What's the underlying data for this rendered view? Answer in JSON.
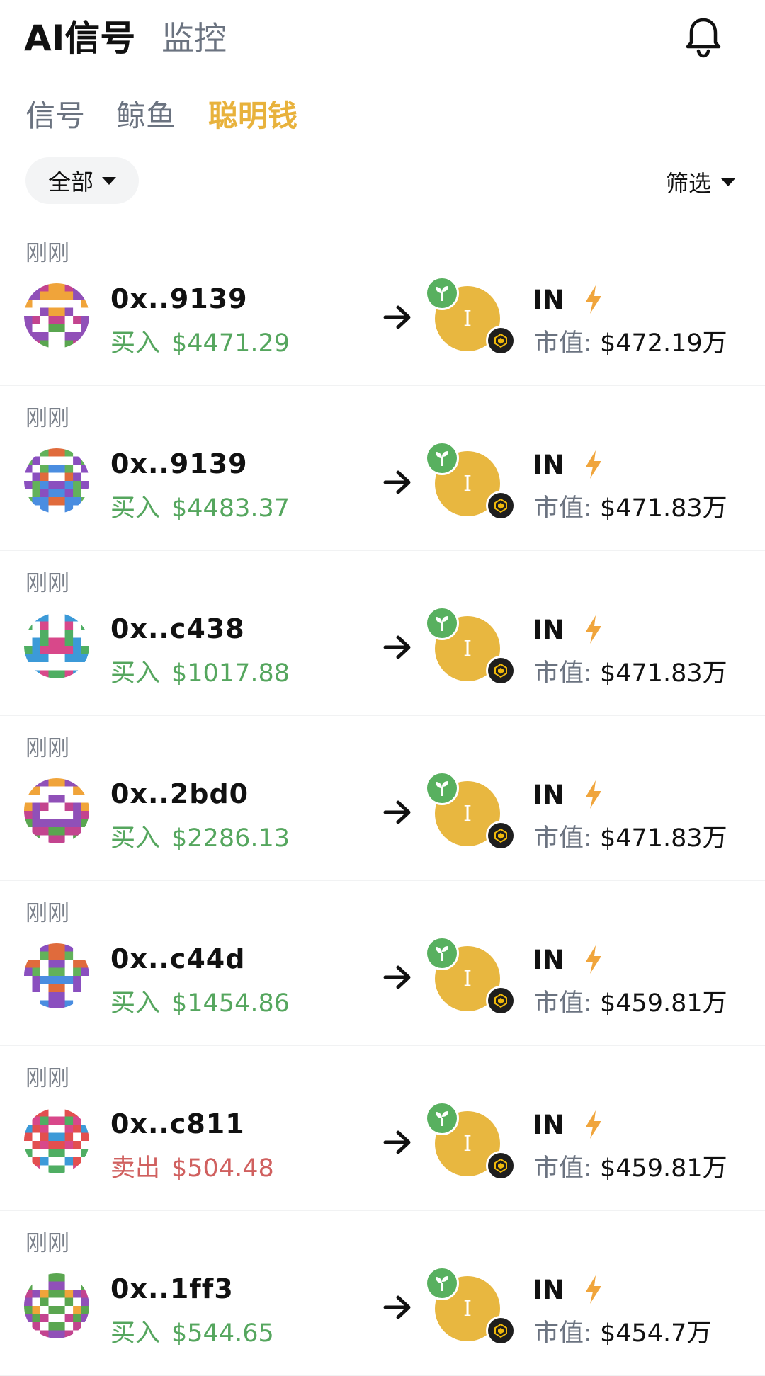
{
  "header": {
    "title": "AI信号",
    "subtitle": "监控"
  },
  "tabs": [
    {
      "label": "信号",
      "active": false
    },
    {
      "label": "鲸鱼",
      "active": false
    },
    {
      "label": "聪明钱",
      "active": true
    }
  ],
  "filters": {
    "scope_label": "全部",
    "filter_label": "筛选"
  },
  "colors": {
    "accent": "#e8b23c",
    "buy": "#55a65e",
    "sell": "#d0605f",
    "token_coin": "#e8b740"
  },
  "icons": {
    "bell": "bell-icon",
    "arrow": "arrow-right-icon",
    "bolt": "lightning-icon",
    "sprout": "sprout-icon",
    "chain": "bnb-chain-icon"
  },
  "feed": [
    {
      "time": "刚刚",
      "address": "0x..9139",
      "action": "买入",
      "type": "buy",
      "amount": "$4471.29",
      "token_letter": "I",
      "token": "IN",
      "mcap_label": "市值:",
      "mcap": "$472.19万"
    },
    {
      "time": "刚刚",
      "address": "0x..9139",
      "action": "买入",
      "type": "buy",
      "amount": "$4483.37",
      "token_letter": "I",
      "token": "IN",
      "mcap_label": "市值:",
      "mcap": "$471.83万"
    },
    {
      "time": "刚刚",
      "address": "0x..c438",
      "action": "买入",
      "type": "buy",
      "amount": "$1017.88",
      "token_letter": "I",
      "token": "IN",
      "mcap_label": "市值:",
      "mcap": "$471.83万"
    },
    {
      "time": "刚刚",
      "address": "0x..2bd0",
      "action": "买入",
      "type": "buy",
      "amount": "$2286.13",
      "token_letter": "I",
      "token": "IN",
      "mcap_label": "市值:",
      "mcap": "$471.83万"
    },
    {
      "time": "刚刚",
      "address": "0x..c44d",
      "action": "买入",
      "type": "buy",
      "amount": "$1454.86",
      "token_letter": "I",
      "token": "IN",
      "mcap_label": "市值:",
      "mcap": "$459.81万"
    },
    {
      "time": "刚刚",
      "address": "0x..c811",
      "action": "卖出",
      "type": "sell",
      "amount": "$504.48",
      "token_letter": "I",
      "token": "IN",
      "mcap_label": "市值:",
      "mcap": "$459.81万"
    },
    {
      "time": "刚刚",
      "address": "0x..1ff3",
      "action": "买入",
      "type": "buy",
      "amount": "$544.65",
      "token_letter": "I",
      "token": "IN",
      "mcap_label": "市值:",
      "mcap": "$454.7万"
    }
  ]
}
